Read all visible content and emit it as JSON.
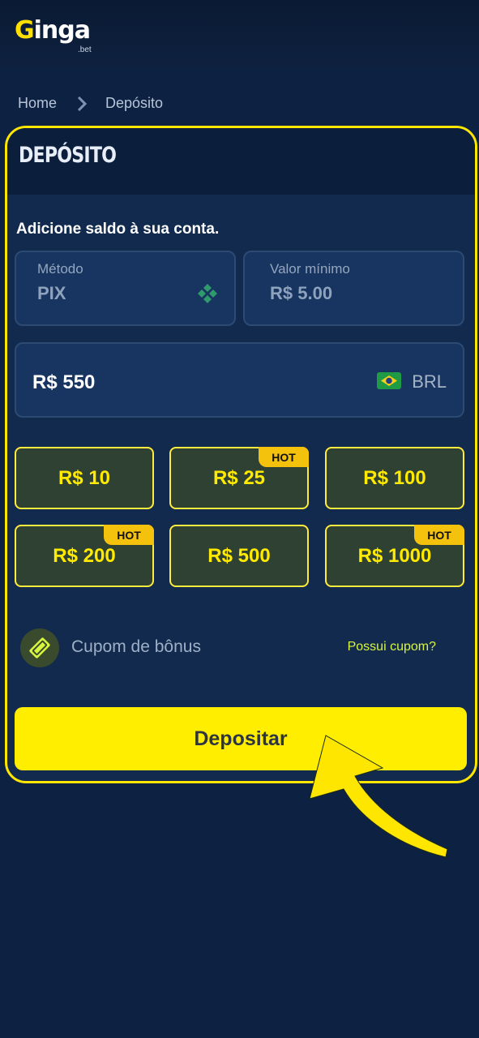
{
  "header": {
    "logo_text": "inga",
    "logo_letter": "G",
    "logo_sub": ".bet"
  },
  "breadcrumb": {
    "home": "Home",
    "current": "Depósito"
  },
  "card": {
    "title": "DEPÓSITO",
    "subtitle": "Adicione saldo à sua conta.",
    "method": {
      "label": "Método",
      "value": "PIX"
    },
    "min_value": {
      "label": "Valor mínimo",
      "value": "R$ 5.00"
    },
    "amount": {
      "value": "R$ 550",
      "currency": "BRL"
    },
    "presets": [
      {
        "label": "R$ 10",
        "hot": ""
      },
      {
        "label": "R$ 25",
        "hot": "HOT"
      },
      {
        "label": "R$ 100",
        "hot": ""
      },
      {
        "label": "R$ 200",
        "hot": "HOT"
      },
      {
        "label": "R$ 500",
        "hot": ""
      },
      {
        "label": "R$ 1000",
        "hot": "HOT"
      }
    ],
    "coupon": {
      "label": "Cupom de bônus",
      "link": "Possui cupom?"
    },
    "deposit_button": "Depositar"
  },
  "colors": {
    "accent": "#ffee00",
    "background": "#0d2242",
    "card": "#112a4e",
    "chip": "#2f4132",
    "link": "#d8f53f"
  }
}
